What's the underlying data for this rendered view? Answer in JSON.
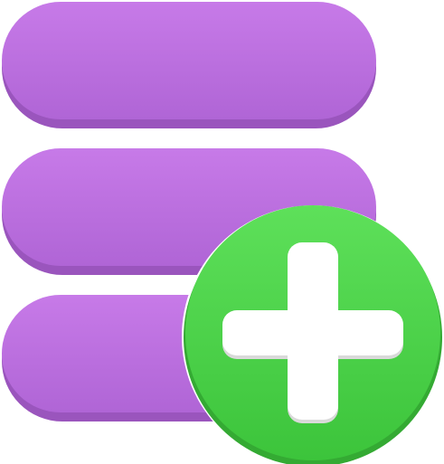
{
  "icon": {
    "name": "add-to-list-icon",
    "bars": [
      {
        "name": "list-bar-top"
      },
      {
        "name": "list-bar-middle"
      },
      {
        "name": "list-bar-bottom"
      }
    ],
    "badge": {
      "name": "plus-badge",
      "symbol": "plus"
    }
  },
  "colors": {
    "bar_top": "#c77ae8",
    "bar_bottom": "#b065d6",
    "bar_shadow": "#9a55bd",
    "badge_top": "#5ee05a",
    "badge_bottom": "#3cc43b",
    "badge_rim": "#34aa33",
    "plus": "#ffffff",
    "plus_shadow": "#d9d9d9"
  }
}
